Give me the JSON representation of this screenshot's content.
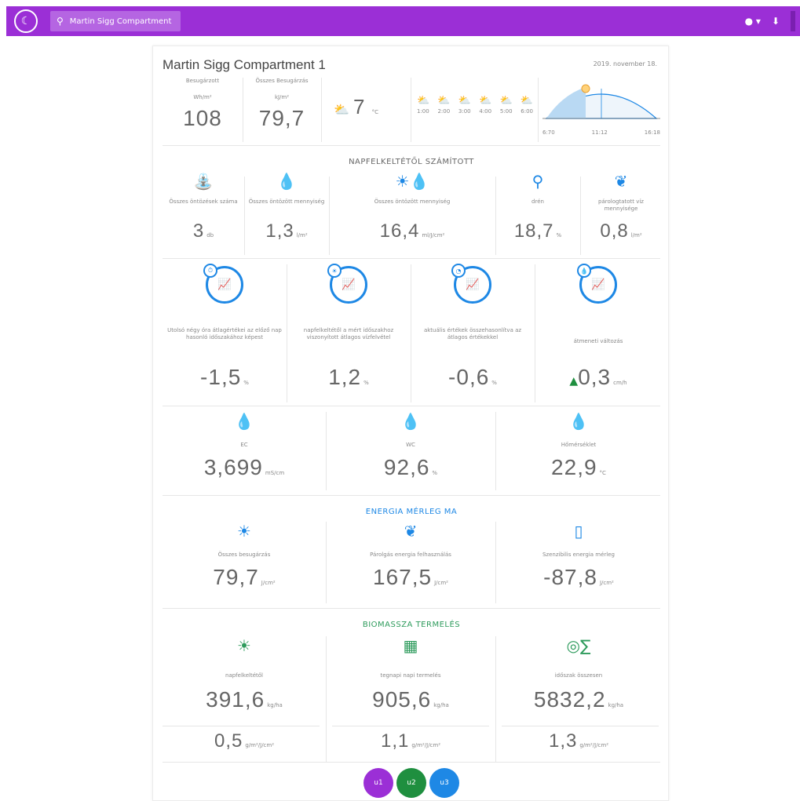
{
  "topbar": {
    "search_text": "Martin Sigg Compartment",
    "icons": [
      "app-logo-icon",
      "search-icon",
      "user-icon",
      "download-icon"
    ]
  },
  "header": {
    "title": "Martin Sigg Compartment 1",
    "date": "2019. november 18."
  },
  "summary": {
    "m1_label": "Besugárzott",
    "m1_unit": "Wh/m²",
    "m1_value": "108",
    "m2_label": "Összes Besugárzás",
    "m2_unit": "kJ/m²",
    "m2_value": "79,7",
    "temp_value": "7",
    "temp_unit": "°C",
    "forecast_times": [
      "1:00",
      "2:00",
      "3:00",
      "4:00",
      "5:00",
      "6:00"
    ],
    "sun_start": "6:70",
    "sun_mid": "11:12",
    "sun_end": "16:18"
  },
  "section1": {
    "heading": "NAPFELKELTÉTŐL SZÁMÍTOTT",
    "items": [
      {
        "label": "Összes öntözések száma",
        "value": "3",
        "unit": "db"
      },
      {
        "label": "Összes öntözött mennyiség",
        "value": "1,3",
        "unit": "l/m²"
      },
      {
        "label": "Összes öntözött mennyiség",
        "value": "16,4",
        "unit": "ml/J/cm²"
      },
      {
        "label": "drén",
        "value": "18,7",
        "unit": "%"
      },
      {
        "label": "párologtatott víz mennyisége",
        "value": "0,8",
        "unit": "l/m²"
      }
    ]
  },
  "section2": {
    "items": [
      {
        "label": "Utolsó négy óra átlagértékei az előző nap hasonló időszakához képest",
        "value": "-1,5",
        "unit": "%"
      },
      {
        "label": "napfelkeltétől a mért időszakhoz viszonyított átlagos vízfelvétel",
        "value": "1,2",
        "unit": "%"
      },
      {
        "label": "aktuális értékek összehasonlítva az átlagos értékekkel",
        "value": "-0,6",
        "unit": "%"
      },
      {
        "label": "átmeneti változás",
        "value": "0,3",
        "unit": "cm/h"
      }
    ]
  },
  "section3": {
    "items": [
      {
        "label": "EC",
        "value": "3,699",
        "unit": "mS/cm"
      },
      {
        "label": "WC",
        "value": "92,6",
        "unit": "%"
      },
      {
        "label": "Hőmérséklet",
        "value": "22,9",
        "unit": "°C"
      }
    ]
  },
  "energy": {
    "heading": "ENERGIA MÉRLEG MA",
    "items": [
      {
        "label": "Összes besugárzás",
        "value": "79,7",
        "unit": "J/cm²"
      },
      {
        "label": "Párolgás energia felhasználás",
        "value": "167,5",
        "unit": "J/cm²"
      },
      {
        "label": "Szenzibilis energia mérleg",
        "value": "-87,8",
        "unit": "J/cm²"
      }
    ]
  },
  "biomass": {
    "heading": "BIOMASSZA TERMELÉS",
    "items": [
      {
        "label": "napfelkeltétől",
        "value": "391,6",
        "unit": "kg/ha",
        "value2": "0,5",
        "unit2": "g/m²/J/cm²"
      },
      {
        "label": "tegnapi napi termelés",
        "value": "905,6",
        "unit": "kg/ha",
        "value2": "1,1",
        "unit2": "g/m²/J/cm²"
      },
      {
        "label": "időszak összesen",
        "value": "5832,2",
        "unit": "kg/ha",
        "value2": "1,3",
        "unit2": "g/m²/J/cm²"
      }
    ]
  },
  "fabs": [
    {
      "label": "u1",
      "color": "#9b2fd6"
    },
    {
      "label": "u2",
      "color": "#1f8f3f"
    },
    {
      "label": "u3",
      "color": "#1e88e5"
    }
  ],
  "colors": {
    "brand": "#9b2fd6",
    "accent_blue": "#1e88e5",
    "accent_green": "#2e9b5c"
  }
}
